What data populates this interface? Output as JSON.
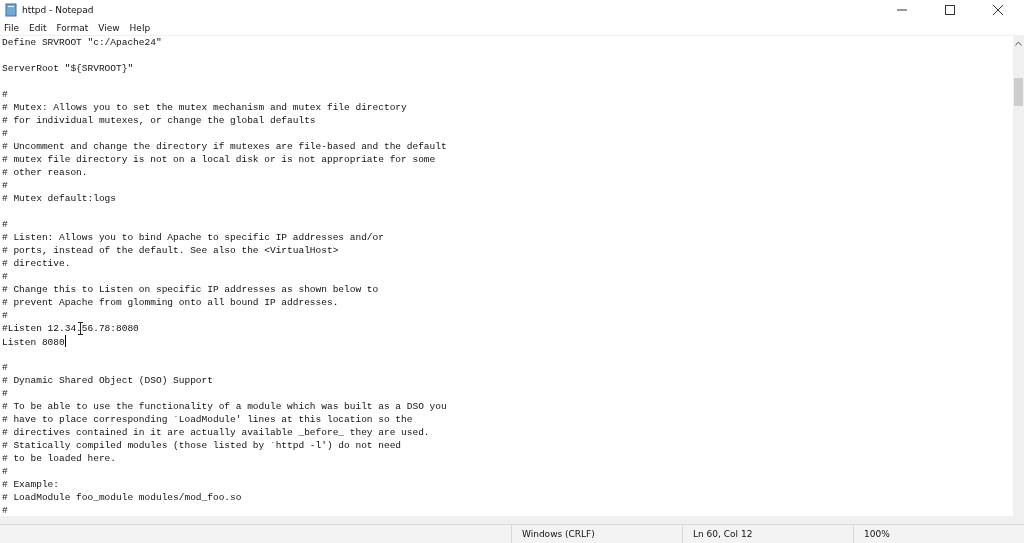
{
  "window": {
    "title": "httpd - Notepad"
  },
  "menu": [
    "File",
    "Edit",
    "Format",
    "View",
    "Help"
  ],
  "editor": {
    "lines": [
      {
        "kind": "text",
        "text": "Define SRVROOT \"c:/Apache24\"",
        "caret": false
      },
      {
        "kind": "blank"
      },
      {
        "kind": "text",
        "text": "ServerRoot \"${SRVROOT}\"",
        "caret": false
      },
      {
        "kind": "blank"
      },
      {
        "kind": "text",
        "text": "#",
        "caret": false
      },
      {
        "kind": "text",
        "text": "# Mutex: Allows you to set the mutex mechanism and mutex file directory",
        "caret": false
      },
      {
        "kind": "text",
        "text": "# for individual mutexes, or change the global defaults",
        "caret": false
      },
      {
        "kind": "text",
        "text": "#",
        "caret": false
      },
      {
        "kind": "text",
        "text": "# Uncomment and change the directory if mutexes are file-based and the default",
        "caret": false
      },
      {
        "kind": "text",
        "text": "# mutex file directory is not on a local disk or is not appropriate for some",
        "caret": false
      },
      {
        "kind": "text",
        "text": "# other reason.",
        "caret": false
      },
      {
        "kind": "text",
        "text": "#",
        "caret": false
      },
      {
        "kind": "text",
        "text": "# Mutex default:logs",
        "caret": false
      },
      {
        "kind": "blank"
      },
      {
        "kind": "text",
        "text": "#",
        "caret": false
      },
      {
        "kind": "text",
        "text": "# Listen: Allows you to bind Apache to specific IP addresses and/or",
        "caret": false
      },
      {
        "kind": "text",
        "text": "# ports, instead of the default. See also the <VirtualHost>",
        "caret": false
      },
      {
        "kind": "text",
        "text": "# directive.",
        "caret": false
      },
      {
        "kind": "text",
        "text": "#",
        "caret": false
      },
      {
        "kind": "text",
        "text": "# Change this to Listen on specific IP addresses as shown below to",
        "caret": false
      },
      {
        "kind": "text",
        "text": "# prevent Apache from glomming onto all bound IP addresses.",
        "caret": false
      },
      {
        "kind": "text",
        "text": "#",
        "caret": false
      },
      {
        "kind": "text",
        "text": "#Listen 12.34.56.78:8080",
        "caret": false,
        "pointer": true
      },
      {
        "kind": "text",
        "text": "Listen 8080",
        "caret": true
      },
      {
        "kind": "blank"
      },
      {
        "kind": "text",
        "text": "#",
        "caret": false
      },
      {
        "kind": "text",
        "text": "# Dynamic Shared Object (DSO) Support",
        "caret": false
      },
      {
        "kind": "text",
        "text": "#",
        "caret": false
      },
      {
        "kind": "text",
        "text": "# To be able to use the functionality of a module which was built as a DSO you",
        "caret": false
      },
      {
        "kind": "text",
        "text": "# have to place corresponding `LoadModule' lines at this location so the",
        "caret": false
      },
      {
        "kind": "text",
        "text": "# directives contained in it are actually available _before_ they are used.",
        "caret": false
      },
      {
        "kind": "text",
        "text": "# Statically compiled modules (those listed by `httpd -l') do not need",
        "caret": false
      },
      {
        "kind": "text",
        "text": "# to be loaded here.",
        "caret": false
      },
      {
        "kind": "text",
        "text": "#",
        "caret": false
      },
      {
        "kind": "text",
        "text": "# Example:",
        "caret": false
      },
      {
        "kind": "text",
        "text": "# LoadModule foo_module modules/mod_foo.so",
        "caret": false
      },
      {
        "kind": "text",
        "text": "#",
        "caret": false
      }
    ]
  },
  "status_bar": {
    "line_ending": "Windows (CRLF)",
    "position": "Ln 60, Col 12",
    "zoom": "100%"
  }
}
